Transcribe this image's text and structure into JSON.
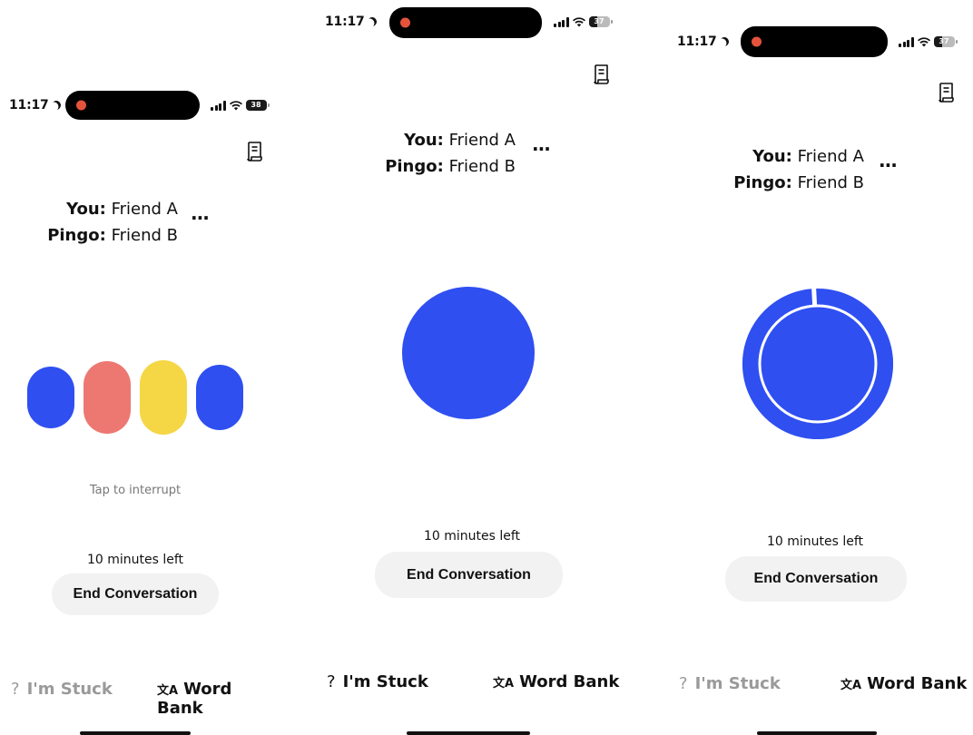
{
  "status": {
    "screen1": {
      "time": "11:17",
      "battery": "38"
    },
    "screen2": {
      "time": "11:17",
      "battery": "37"
    },
    "screen3": {
      "time": "11:17",
      "battery": "37"
    }
  },
  "roles": {
    "you_label": "You:",
    "you_value": "Friend A",
    "pingo_label": "Pingo:",
    "pingo_value": "Friend B",
    "more": "···"
  },
  "tap_to_interrupt": "Tap to interrupt",
  "time_left": "10 minutes left",
  "end_button": "End Conversation",
  "stuck_button": {
    "glyph": "?",
    "label": "I'm Stuck"
  },
  "word_bank_button": {
    "glyph": "文A",
    "label": "Word Bank"
  },
  "colors": {
    "blue": "#2f4ff1",
    "coral": "#ed7872",
    "yellow": "#f5d645",
    "recording": "#e5533d",
    "button_bg": "#f2f2f2"
  },
  "icons": [
    "moon-icon",
    "record-dot-icon",
    "signal-icon",
    "wifi-icon",
    "battery-icon",
    "transcript-icon",
    "more-icon",
    "question-icon",
    "translate-icon"
  ]
}
